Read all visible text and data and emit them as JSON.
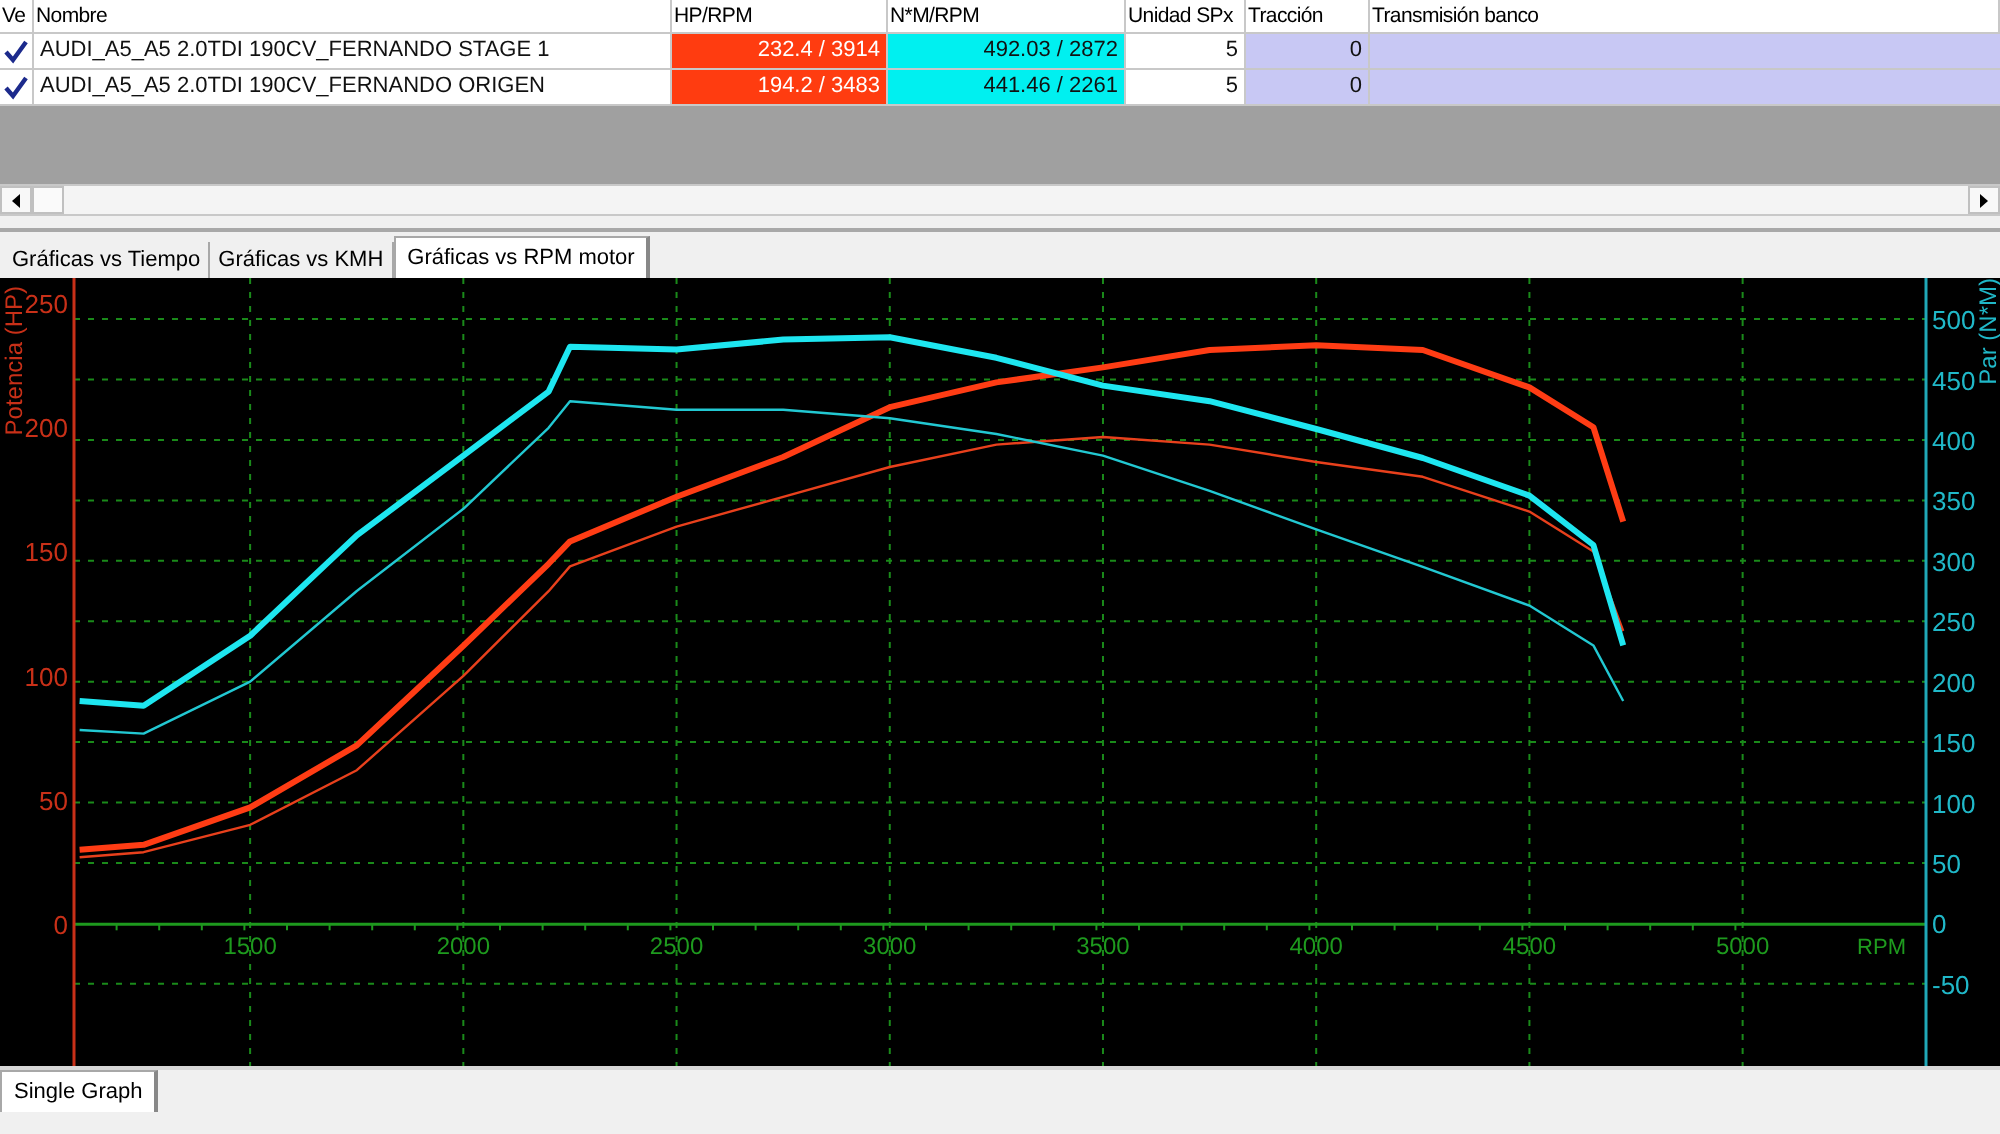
{
  "table": {
    "columns": [
      "Ve",
      "Nombre",
      "HP/RPM",
      "N*M/RPM",
      "Unidad SPx",
      "Tracción",
      "Transmisión banco"
    ],
    "rows": [
      {
        "checked": true,
        "name": "AUDI_A5_A5 2.0TDI 190CV_FERNANDO STAGE 1",
        "hp_rpm": "232.4 / 3914",
        "nm_rpm": "492.03 / 2872",
        "unidad_spx": "5",
        "traccion": "0"
      },
      {
        "checked": true,
        "name": "AUDI_A5_A5 2.0TDI 190CV_FERNANDO ORIGEN",
        "hp_rpm": "194.2 / 3483",
        "nm_rpm": "441.46 / 2261",
        "unidad_spx": "5",
        "traccion": "0"
      }
    ]
  },
  "tabs": [
    {
      "label": "Gráficas vs Tiempo",
      "selected": false
    },
    {
      "label": "Gráficas vs KMH",
      "selected": false
    },
    {
      "label": "Gráficas vs RPM motor",
      "selected": true
    }
  ],
  "chart_data": {
    "type": "line",
    "grid": true,
    "xlabel": "RPM",
    "ylabel": "Potencia (HP)",
    "y2label": "Par (N*M)",
    "xlim": [
      1087,
      5430
    ],
    "ylim": [
      -57,
      260
    ],
    "y2lim": [
      -118,
      534
    ],
    "xticks": [
      1500,
      2000,
      2500,
      3000,
      3500,
      4000,
      4500,
      5000
    ],
    "yticks": [
      0,
      50,
      100,
      150,
      200,
      250
    ],
    "y2ticks": [
      -50,
      0,
      50,
      100,
      150,
      200,
      250,
      300,
      350,
      400,
      450,
      500
    ],
    "x": [
      1100,
      1250,
      1500,
      1750,
      2000,
      2200,
      2250,
      2500,
      2750,
      3000,
      3250,
      3500,
      3750,
      4000,
      4250,
      4500,
      4650,
      4720
    ],
    "series": [
      {
        "color": "#ff3c14",
        "values": [
          30,
          32,
          47,
          72,
          112,
          145,
          154,
          172,
          188,
          208,
          218,
          224,
          231,
          233,
          231,
          216,
          200,
          162
        ]
      },
      {
        "color": "#e8401c",
        "values": [
          27,
          29,
          40,
          62,
          100,
          134,
          144,
          160,
          172,
          184,
          193,
          196,
          193,
          186,
          180,
          166,
          150,
          118
        ]
      },
      {
        "color": "#1ee6f0",
        "axis": "y2",
        "values": [
          184,
          180,
          238,
          321,
          387,
          440,
          477,
          475,
          483,
          485,
          468,
          445,
          432,
          409,
          385,
          354,
          313,
          230
        ]
      },
      {
        "color": "#22c8d2",
        "axis": "y2",
        "values": [
          160,
          157,
          200,
          275,
          343,
          410,
          432,
          425,
          425,
          418,
          405,
          387,
          358,
          326,
          295,
          263,
          230,
          184
        ]
      }
    ]
  },
  "bottom_tabs": [
    {
      "label": "Single Graph",
      "selected": true
    }
  ]
}
